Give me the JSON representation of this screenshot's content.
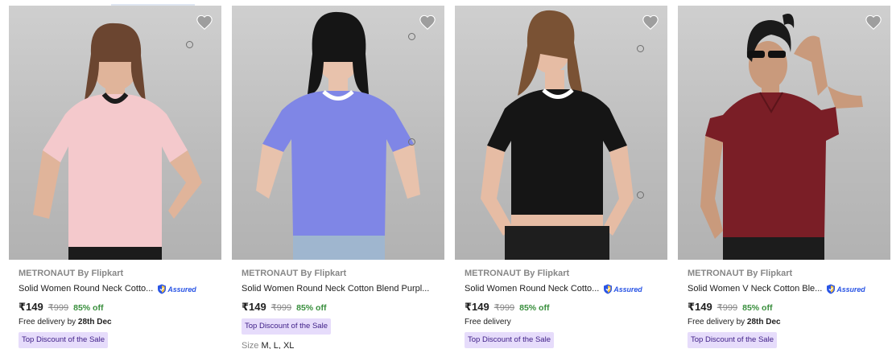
{
  "products": [
    {
      "brand": "METRONAUT By Flipkart",
      "title": "Solid Women Round Neck Cotto...",
      "assured": true,
      "assured_label": "Assured",
      "price": "₹149",
      "mrp": "₹999",
      "discount": "85% off",
      "delivery_prefix": "Free delivery by ",
      "delivery_date": "28th Dec",
      "badge": "Top Discount of the Sale",
      "shirt_color": "#f4c9cc",
      "trim_color": "#1c1c1c",
      "neckline": "round"
    },
    {
      "brand": "METRONAUT By Flipkart",
      "title": "Solid Women Round Neck Cotton Blend Purpl...",
      "assured": false,
      "price": "₹149",
      "mrp": "₹999",
      "discount": "85% off",
      "badge": "Top Discount of the Sale",
      "size_label": "Size",
      "size_values": "M, L, XL",
      "shirt_color": "#7f86e6",
      "trim_color": "#ffffff",
      "neckline": "round"
    },
    {
      "brand": "METRONAUT By Flipkart",
      "title": "Solid Women Round Neck Cotto...",
      "assured": true,
      "assured_label": "Assured",
      "price": "₹149",
      "mrp": "₹999",
      "discount": "85% off",
      "delivery_text": "Free delivery",
      "badge": "Top Discount of the Sale",
      "shirt_color": "#151515",
      "trim_color": "#ffffff",
      "neckline": "round"
    },
    {
      "brand": "METRONAUT By Flipkart",
      "title": "Solid Women V Neck Cotton Ble...",
      "assured": true,
      "assured_label": "Assured",
      "price": "₹149",
      "mrp": "₹999",
      "discount": "85% off",
      "delivery_prefix": "Free delivery by ",
      "delivery_date": "28th Dec",
      "badge": "Top Discount of the Sale",
      "shirt_color": "#7a1e26",
      "trim_color": "#7a1e26",
      "neckline": "v"
    }
  ],
  "icons": {
    "wishlist": "heart-icon",
    "assured": "assured-shield-icon"
  },
  "colors": {
    "discount_green": "#388e3c",
    "badge_bg": "#e6dcfb",
    "badge_text": "#3d1d86",
    "assured_blue": "#2a55e5",
    "muted": "#878787"
  }
}
